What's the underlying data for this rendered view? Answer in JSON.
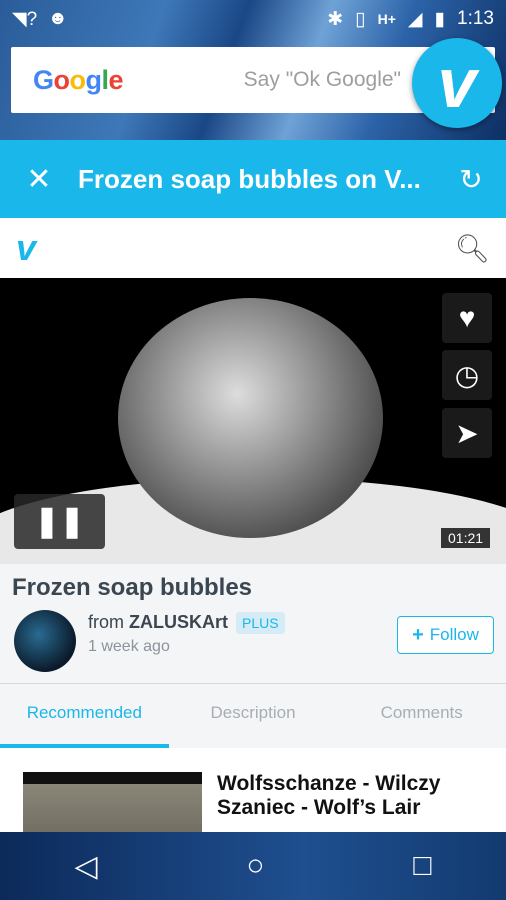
{
  "status_bar": {
    "time": "1:13",
    "network": "H+"
  },
  "google_bar": {
    "logo": "Google",
    "hint": "Say \"Ok Google\""
  },
  "app_bar": {
    "title": "Frozen soap bubbles on V...",
    "close_icon": "close-icon",
    "refresh_icon": "refresh-icon"
  },
  "header": {
    "logo": "v",
    "search_icon": "search-icon"
  },
  "video": {
    "duration": "01:21",
    "state": "playing",
    "actions": [
      "heart-icon",
      "clock-icon",
      "send-icon"
    ]
  },
  "info": {
    "title": "Frozen soap bubbles",
    "from_label": "from",
    "author": "ZALUSKArt",
    "badge": "PLUS",
    "posted": "1 week ago",
    "follow_label": "Follow"
  },
  "tabs": [
    {
      "label": "Recommended",
      "active": true
    },
    {
      "label": "Description",
      "active": false
    },
    {
      "label": "Comments",
      "active": false
    }
  ],
  "recommended": [
    {
      "title": "Wolfsschanze - Wilczy Szaniec - Wolf’s Lair"
    }
  ],
  "colors": {
    "accent": "#1ab7ea",
    "title_text": "#3a4650"
  }
}
